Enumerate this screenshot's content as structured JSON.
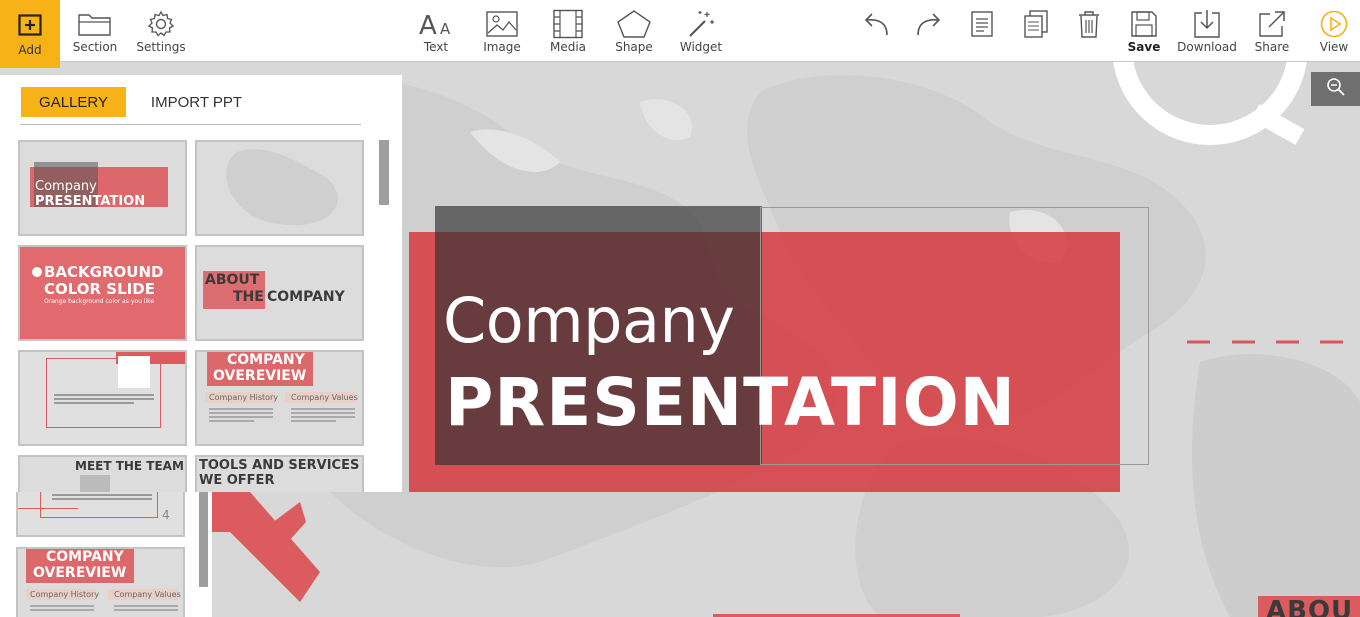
{
  "toolbar": {
    "add": "Add",
    "section": "Section",
    "settings": "Settings",
    "text": "Text",
    "image": "Image",
    "media": "Media",
    "shape": "Shape",
    "widget": "Widget",
    "save": "Save",
    "download": "Download",
    "share": "Share",
    "view": "View"
  },
  "gallery": {
    "tabs": {
      "gallery": "GALLERY",
      "import": "IMPORT PPT"
    },
    "thumbs": {
      "t1_line1": "Company",
      "t1_line2": "PRESENTATION",
      "t3_line1": "BACKGROUND",
      "t3_line2": "COLOR SLIDE",
      "t3_sub": "Orange background color as you like",
      "t4_line1": "ABOUT",
      "t4_line2": "THE",
      "t4_line3": "COMPANY",
      "t6_line1": "COMPANY",
      "t6_line2": "OVEREVIEW",
      "t6_col1": "Company History",
      "t6_col2": "Company Values",
      "t7_title": "MEET THE TEAM",
      "t8_title": "TOOLS AND SERVICES",
      "t8_title2": "WE OFFER",
      "t9_num": "4",
      "t10_line1": "COMPANY",
      "t10_line2": "OVEREVIEW",
      "t10_col1": "Company History",
      "t10_col2": "Company Values"
    }
  },
  "slide": {
    "title_line1": "Company",
    "title_line2": "PRESENTATION",
    "next_slide_peek": "ABOU"
  },
  "colors": {
    "accent": "#f7b218",
    "slide_red": "#d63a3e",
    "view_icon": "#f7b218"
  }
}
